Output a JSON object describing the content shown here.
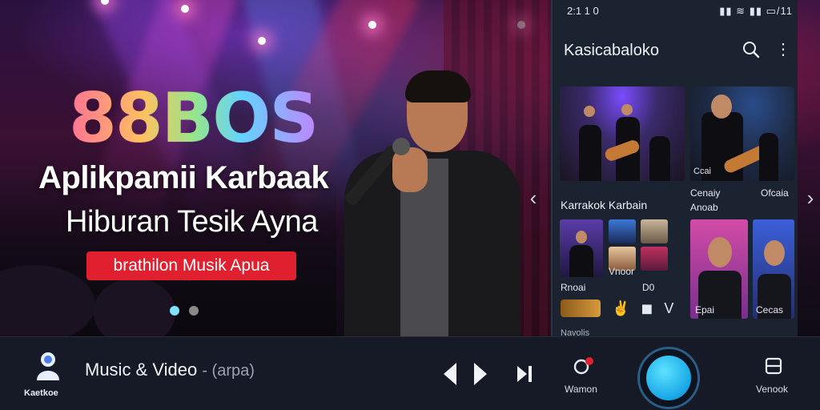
{
  "hero": {
    "brand": "88BOS",
    "headline_line1": "Aplikpamii Karbaak",
    "headline_line2": "Hiburan Tesik Ayna",
    "cta_label": "brathilon Musik Apua",
    "carousel_dots": 2,
    "carousel_active_index": 0
  },
  "phone": {
    "status_time": "2:1 1 0",
    "status_icons": "▮▮ ≋ ▮▮ ▭/11",
    "app_title": "Kasicabaloko",
    "section_title": "Karrakok Karbain",
    "tile_caption_1": "Cenaiy",
    "tile_caption_2": "Ofcaia",
    "tile_caption_3": "Anoab",
    "grid_caption_1": "Rnoai",
    "grid_caption_2": "Vnoor",
    "grid_caption_3": "D0",
    "grid_caption_4": "Epai",
    "grid_caption_5": "Cecas",
    "footer_text": "Navolis"
  },
  "bottom_bar": {
    "app_label": "Kaetkoe",
    "now_playing_title": "Music & Video",
    "now_playing_sub": "- (arpa)",
    "mic_label": "Wamon",
    "right_label": "Venook"
  },
  "colors": {
    "accent_blue": "#18a6e6",
    "cta_red": "#e0202f",
    "bar_bg": "#151a26",
    "phone_bg": "#1b2230"
  },
  "icons": {
    "search": "search-icon",
    "menu": "more-vertical-icon",
    "prev": "play-left-icon",
    "next": "play-right-icon",
    "skip": "skip-next-icon",
    "mic": "mic-icon",
    "record": "record-icon"
  }
}
